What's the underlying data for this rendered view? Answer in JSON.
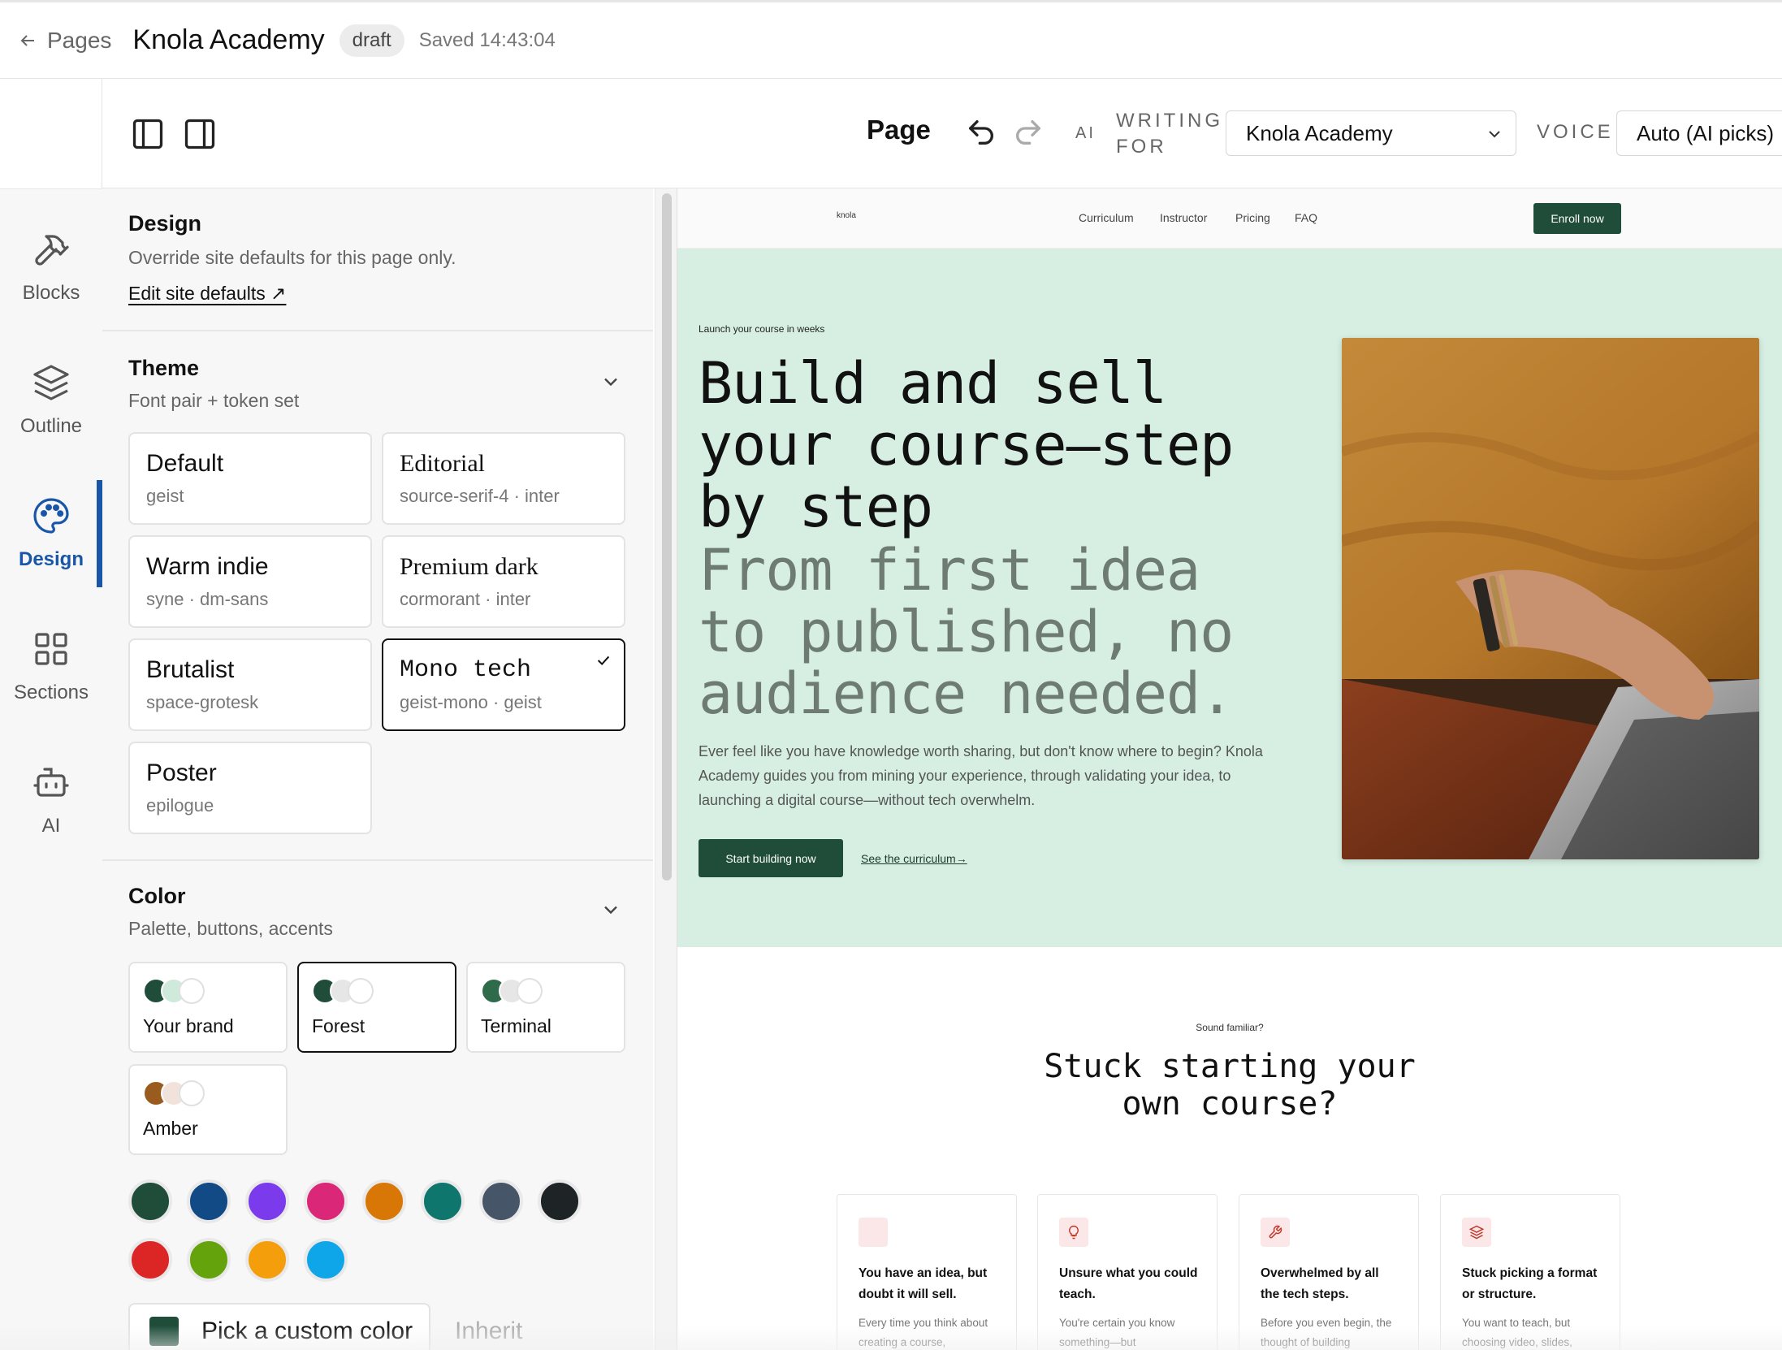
{
  "topbar": {
    "back_label": "Pages",
    "title": "Knola Academy",
    "badge": "draft",
    "saved": "Saved 14:43:04"
  },
  "rail": {
    "items": [
      {
        "label": "Blocks",
        "icon": "hammer-icon"
      },
      {
        "label": "Outline",
        "icon": "layers-icon"
      },
      {
        "label": "Design",
        "icon": "palette-icon",
        "active": true
      },
      {
        "label": "Sections",
        "icon": "grid-icon"
      },
      {
        "label": "AI",
        "icon": "robot-icon"
      }
    ]
  },
  "toolbar": {
    "page_label": "Page",
    "ai_label": "AI",
    "writing_label_1": "WRITING",
    "writing_label_2": "FOR",
    "writing_for_value": "Knola Academy",
    "voice_label": "VOICE",
    "voice_value": "Auto (AI picks)"
  },
  "design": {
    "title": "Design",
    "subtitle": "Override site defaults for this page only.",
    "edit_link": "Edit site defaults ↗"
  },
  "theme": {
    "title": "Theme",
    "subtitle": "Font pair + token set",
    "options": [
      {
        "name": "Default",
        "fonts": "geist"
      },
      {
        "name": "Editorial",
        "fonts": "source-serif-4 · inter"
      },
      {
        "name": "Warm indie",
        "fonts": "syne · dm-sans"
      },
      {
        "name": "Premium dark",
        "fonts": "cormorant · inter"
      },
      {
        "name": "Brutalist",
        "fonts": "space-grotesk"
      },
      {
        "name": "Mono tech",
        "fonts": "geist-mono · geist",
        "selected": true
      },
      {
        "name": "Poster",
        "fonts": "epilogue"
      }
    ]
  },
  "color": {
    "title": "Color",
    "subtitle": "Palette, buttons, accents",
    "palettes": [
      {
        "name": "Your brand",
        "dots": [
          "#1f4d3a",
          "#cfeadb",
          "#ffffff"
        ]
      },
      {
        "name": "Forest",
        "dots": [
          "#1f4d3a",
          "#e6e6e6",
          "#ffffff"
        ],
        "selected": true
      },
      {
        "name": "Terminal",
        "dots": [
          "#2f6b4a",
          "#e6e6e6",
          "#ffffff"
        ]
      },
      {
        "name": "Amber",
        "dots": [
          "#9a5b1e",
          "#f1e3db",
          "#ffffff"
        ]
      }
    ],
    "swatches": [
      "#1f4d3a",
      "#124a86",
      "#7c3aed",
      "#db2777",
      "#d97706",
      "#0f766e",
      "#475569",
      "#1e2326",
      "#dc2626",
      "#65a30d",
      "#f59e0b",
      "#0ea5e9"
    ],
    "custom_label": "Pick a custom color",
    "inherit_label": "Inherit"
  },
  "preview": {
    "logo": "knola",
    "nav_links": [
      "Curriculum",
      "Instructor",
      "Pricing",
      "FAQ"
    ],
    "enroll": "Enroll now",
    "hero_eyebrow": "Launch your course in weeks",
    "hero_title": "Build and sell your course—step by step",
    "hero_subtitle": "From first idea to published, no audience needed.",
    "hero_body": "Ever feel like you have knowledge worth sharing, but don't know where to begin? Knola Academy guides you from mining your experience, through validating your idea, to launching a digital course—without tech overwhelm.",
    "cta_primary": "Start building now",
    "cta_secondary": "See the curriculum→",
    "section2_eyebrow": "Sound familiar?",
    "section2_title": "Stuck starting your own course?",
    "cards": [
      {
        "title": "You have an idea, but doubt it will sell.",
        "body": "Every time you think about creating a course,"
      },
      {
        "title": "Unsure what you could teach.",
        "body": "You're certain you know something—but"
      },
      {
        "title": "Overwhelmed by all the tech steps.",
        "body": "Before you even begin, the thought of building"
      },
      {
        "title": "Stuck picking a format or structure.",
        "body": "You want to teach, but choosing video, slides,"
      }
    ]
  }
}
